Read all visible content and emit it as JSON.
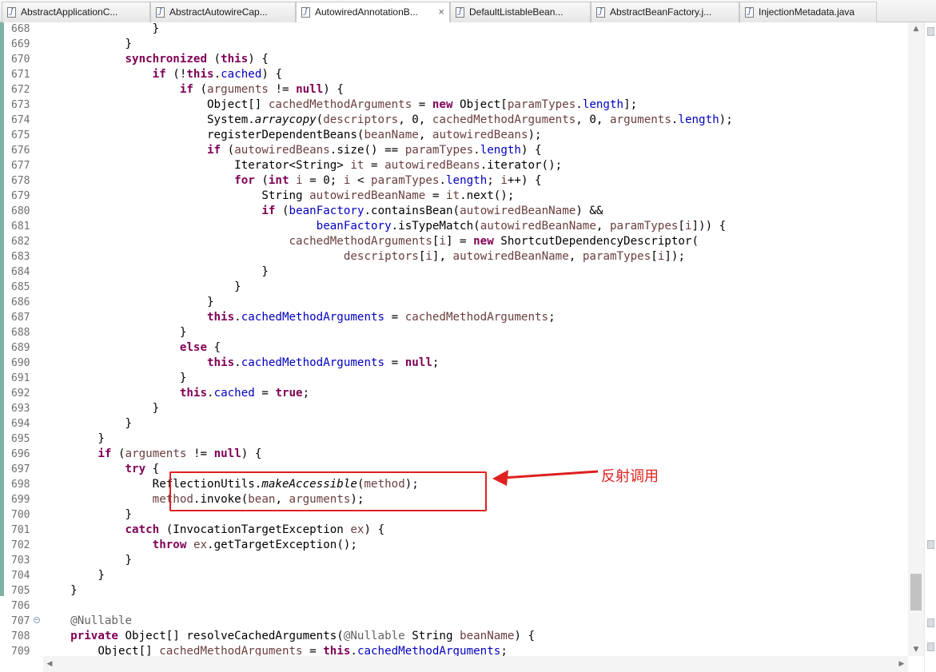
{
  "tabs": [
    {
      "label": "AbstractApplicationC...",
      "active": false
    },
    {
      "label": "AbstractAutowireCap...",
      "active": false
    },
    {
      "label": "AutowiredAnnotationB...",
      "active": true
    },
    {
      "label": "DefaultListableBean...",
      "active": false
    },
    {
      "label": "AbstractBeanFactory.j...",
      "active": false
    },
    {
      "label": "InjectionMetadata.java",
      "active": false
    }
  ],
  "tab_close_glyph": "×",
  "tab_file_glyph": "J",
  "annotation": {
    "text": "反射调用",
    "color": "#e02020"
  },
  "code_lines": [
    {
      "n": "668",
      "tokens": [
        [
          "p",
          "                }"
        ]
      ]
    },
    {
      "n": "669",
      "tokens": [
        [
          "p",
          "            }"
        ]
      ]
    },
    {
      "n": "670",
      "tokens": [
        [
          "p",
          "            "
        ],
        [
          "kw",
          "synchronized"
        ],
        [
          "p",
          " ("
        ],
        [
          "kw",
          "this"
        ],
        [
          "p",
          ") {"
        ]
      ]
    },
    {
      "n": "671",
      "tokens": [
        [
          "p",
          "                "
        ],
        [
          "kw",
          "if"
        ],
        [
          "p",
          " (!"
        ],
        [
          "kw",
          "this"
        ],
        [
          "p",
          "."
        ],
        [
          "fld",
          "cached"
        ],
        [
          "p",
          ") {"
        ]
      ]
    },
    {
      "n": "672",
      "tokens": [
        [
          "p",
          "                    "
        ],
        [
          "kw",
          "if"
        ],
        [
          "p",
          " ("
        ],
        [
          "var",
          "arguments"
        ],
        [
          "p",
          " != "
        ],
        [
          "kw",
          "null"
        ],
        [
          "p",
          ") {"
        ]
      ]
    },
    {
      "n": "673",
      "tokens": [
        [
          "p",
          "                        Object[] "
        ],
        [
          "var",
          "cachedMethodArguments"
        ],
        [
          "p",
          " = "
        ],
        [
          "kw",
          "new"
        ],
        [
          "p",
          " Object["
        ],
        [
          "var",
          "paramTypes"
        ],
        [
          "p",
          "."
        ],
        [
          "fld",
          "length"
        ],
        [
          "p",
          "];"
        ]
      ]
    },
    {
      "n": "674",
      "tokens": [
        [
          "p",
          "                        System."
        ],
        [
          "it",
          "arraycopy"
        ],
        [
          "p",
          "("
        ],
        [
          "var",
          "descriptors"
        ],
        [
          "p",
          ", 0, "
        ],
        [
          "var",
          "cachedMethodArguments"
        ],
        [
          "p",
          ", 0, "
        ],
        [
          "var",
          "arguments"
        ],
        [
          "p",
          "."
        ],
        [
          "fld",
          "length"
        ],
        [
          "p",
          ");"
        ]
      ]
    },
    {
      "n": "675",
      "tokens": [
        [
          "p",
          "                        registerDependentBeans("
        ],
        [
          "var",
          "beanName"
        ],
        [
          "p",
          ", "
        ],
        [
          "var",
          "autowiredBeans"
        ],
        [
          "p",
          ");"
        ]
      ]
    },
    {
      "n": "676",
      "tokens": [
        [
          "p",
          "                        "
        ],
        [
          "kw",
          "if"
        ],
        [
          "p",
          " ("
        ],
        [
          "var",
          "autowiredBeans"
        ],
        [
          "p",
          ".size() == "
        ],
        [
          "var",
          "paramTypes"
        ],
        [
          "p",
          "."
        ],
        [
          "fld",
          "length"
        ],
        [
          "p",
          ") {"
        ]
      ]
    },
    {
      "n": "677",
      "tokens": [
        [
          "p",
          "                            Iterator<String> "
        ],
        [
          "var",
          "it"
        ],
        [
          "p",
          " = "
        ],
        [
          "var",
          "autowiredBeans"
        ],
        [
          "p",
          ".iterator();"
        ]
      ]
    },
    {
      "n": "678",
      "tokens": [
        [
          "p",
          "                            "
        ],
        [
          "kw",
          "for"
        ],
        [
          "p",
          " ("
        ],
        [
          "kw",
          "int"
        ],
        [
          "p",
          " "
        ],
        [
          "var",
          "i"
        ],
        [
          "p",
          " = 0; "
        ],
        [
          "var",
          "i"
        ],
        [
          "p",
          " < "
        ],
        [
          "var",
          "paramTypes"
        ],
        [
          "p",
          "."
        ],
        [
          "fld",
          "length"
        ],
        [
          "p",
          "; "
        ],
        [
          "var",
          "i"
        ],
        [
          "p",
          "++) {"
        ]
      ]
    },
    {
      "n": "679",
      "tokens": [
        [
          "p",
          "                                String "
        ],
        [
          "var",
          "autowiredBeanName"
        ],
        [
          "p",
          " = "
        ],
        [
          "var",
          "it"
        ],
        [
          "p",
          ".next();"
        ]
      ]
    },
    {
      "n": "680",
      "tokens": [
        [
          "p",
          "                                "
        ],
        [
          "kw",
          "if"
        ],
        [
          "p",
          " ("
        ],
        [
          "fld",
          "beanFactory"
        ],
        [
          "p",
          ".containsBean("
        ],
        [
          "var",
          "autowiredBeanName"
        ],
        [
          "p",
          ") &&"
        ]
      ]
    },
    {
      "n": "681",
      "tokens": [
        [
          "p",
          "                                        "
        ],
        [
          "fld",
          "beanFactory"
        ],
        [
          "p",
          ".isTypeMatch("
        ],
        [
          "var",
          "autowiredBeanName"
        ],
        [
          "p",
          ", "
        ],
        [
          "var",
          "paramTypes"
        ],
        [
          "p",
          "["
        ],
        [
          "var",
          "i"
        ],
        [
          "p",
          "])) {"
        ]
      ]
    },
    {
      "n": "682",
      "tokens": [
        [
          "p",
          "                                    "
        ],
        [
          "var",
          "cachedMethodArguments"
        ],
        [
          "p",
          "["
        ],
        [
          "var",
          "i"
        ],
        [
          "p",
          "] = "
        ],
        [
          "kw",
          "new"
        ],
        [
          "p",
          " ShortcutDependencyDescriptor("
        ]
      ]
    },
    {
      "n": "683",
      "tokens": [
        [
          "p",
          "                                            "
        ],
        [
          "var",
          "descriptors"
        ],
        [
          "p",
          "["
        ],
        [
          "var",
          "i"
        ],
        [
          "p",
          "], "
        ],
        [
          "var",
          "autowiredBeanName"
        ],
        [
          "p",
          ", "
        ],
        [
          "var",
          "paramTypes"
        ],
        [
          "p",
          "["
        ],
        [
          "var",
          "i"
        ],
        [
          "p",
          "]);"
        ]
      ]
    },
    {
      "n": "684",
      "tokens": [
        [
          "p",
          "                                }"
        ]
      ]
    },
    {
      "n": "685",
      "tokens": [
        [
          "p",
          "                            }"
        ]
      ]
    },
    {
      "n": "686",
      "tokens": [
        [
          "p",
          "                        }"
        ]
      ]
    },
    {
      "n": "687",
      "tokens": [
        [
          "p",
          "                        "
        ],
        [
          "kw",
          "this"
        ],
        [
          "p",
          "."
        ],
        [
          "fld",
          "cachedMethodArguments"
        ],
        [
          "p",
          " = "
        ],
        [
          "var",
          "cachedMethodArguments"
        ],
        [
          "p",
          ";"
        ]
      ]
    },
    {
      "n": "688",
      "tokens": [
        [
          "p",
          "                    }"
        ]
      ]
    },
    {
      "n": "689",
      "tokens": [
        [
          "p",
          "                    "
        ],
        [
          "kw",
          "else"
        ],
        [
          "p",
          " {"
        ]
      ]
    },
    {
      "n": "690",
      "tokens": [
        [
          "p",
          "                        "
        ],
        [
          "kw",
          "this"
        ],
        [
          "p",
          "."
        ],
        [
          "fld",
          "cachedMethodArguments"
        ],
        [
          "p",
          " = "
        ],
        [
          "kw",
          "null"
        ],
        [
          "p",
          ";"
        ]
      ]
    },
    {
      "n": "691",
      "tokens": [
        [
          "p",
          "                    }"
        ]
      ]
    },
    {
      "n": "692",
      "tokens": [
        [
          "p",
          "                    "
        ],
        [
          "kw",
          "this"
        ],
        [
          "p",
          "."
        ],
        [
          "fld",
          "cached"
        ],
        [
          "p",
          " = "
        ],
        [
          "kw",
          "true"
        ],
        [
          "p",
          ";"
        ]
      ]
    },
    {
      "n": "693",
      "tokens": [
        [
          "p",
          "                }"
        ]
      ]
    },
    {
      "n": "694",
      "tokens": [
        [
          "p",
          "            }"
        ]
      ]
    },
    {
      "n": "695",
      "tokens": [
        [
          "p",
          "        }"
        ]
      ]
    },
    {
      "n": "696",
      "tokens": [
        [
          "p",
          "        "
        ],
        [
          "kw",
          "if"
        ],
        [
          "p",
          " ("
        ],
        [
          "var",
          "arguments"
        ],
        [
          "p",
          " != "
        ],
        [
          "kw",
          "null"
        ],
        [
          "p",
          ") {"
        ]
      ]
    },
    {
      "n": "697",
      "tokens": [
        [
          "p",
          "            "
        ],
        [
          "kw",
          "try"
        ],
        [
          "p",
          " {"
        ]
      ]
    },
    {
      "n": "698",
      "tokens": [
        [
          "p",
          "                ReflectionUtils."
        ],
        [
          "it",
          "makeAccessible"
        ],
        [
          "p",
          "("
        ],
        [
          "var",
          "method"
        ],
        [
          "p",
          ");"
        ]
      ]
    },
    {
      "n": "699",
      "tokens": [
        [
          "p",
          "                "
        ],
        [
          "var",
          "method"
        ],
        [
          "p",
          ".invoke("
        ],
        [
          "var",
          "bean"
        ],
        [
          "p",
          ", "
        ],
        [
          "var",
          "arguments"
        ],
        [
          "p",
          ");"
        ]
      ]
    },
    {
      "n": "700",
      "tokens": [
        [
          "p",
          "            }"
        ]
      ]
    },
    {
      "n": "701",
      "tokens": [
        [
          "p",
          "            "
        ],
        [
          "kw",
          "catch"
        ],
        [
          "p",
          " (InvocationTargetException "
        ],
        [
          "var",
          "ex"
        ],
        [
          "p",
          ") {"
        ]
      ]
    },
    {
      "n": "702",
      "tokens": [
        [
          "p",
          "                "
        ],
        [
          "kw",
          "throw"
        ],
        [
          "p",
          " "
        ],
        [
          "var",
          "ex"
        ],
        [
          "p",
          ".getTargetException();"
        ]
      ]
    },
    {
      "n": "703",
      "tokens": [
        [
          "p",
          "            }"
        ]
      ]
    },
    {
      "n": "704",
      "tokens": [
        [
          "p",
          "        }"
        ]
      ]
    },
    {
      "n": "705",
      "tokens": [
        [
          "p",
          "    }"
        ]
      ]
    },
    {
      "n": "706",
      "tokens": [
        [
          "p",
          ""
        ]
      ]
    },
    {
      "n": "707",
      "fold": true,
      "tokens": [
        [
          "p",
          "    "
        ],
        [
          "ann",
          "@Nullable"
        ]
      ]
    },
    {
      "n": "708",
      "tokens": [
        [
          "p",
          "    "
        ],
        [
          "kw",
          "private"
        ],
        [
          "p",
          " Object[] resolveCachedArguments("
        ],
        [
          "ann",
          "@Nullable"
        ],
        [
          "p",
          " String "
        ],
        [
          "var",
          "beanName"
        ],
        [
          "p",
          ") {"
        ]
      ]
    },
    {
      "n": "709",
      "tokens": [
        [
          "p",
          "        Object[] "
        ],
        [
          "var",
          "cachedMethodArguments"
        ],
        [
          "p",
          " = "
        ],
        [
          "kw",
          "this"
        ],
        [
          "p",
          "."
        ],
        [
          "fld",
          "cachedMethodArguments"
        ],
        [
          "p",
          ";"
        ]
      ]
    }
  ]
}
